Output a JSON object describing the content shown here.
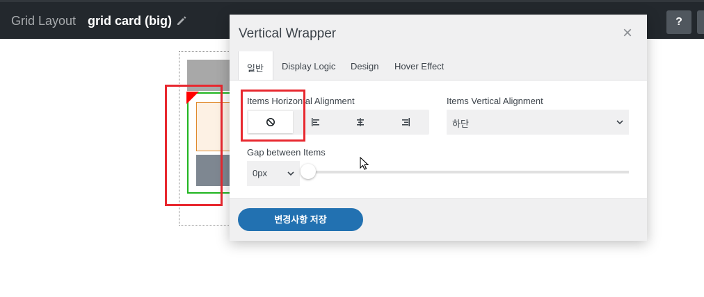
{
  "topbar": {
    "crumb": "Grid Layout",
    "title": "grid card (big)",
    "help_label": "?"
  },
  "dialog": {
    "title": "Vertical Wrapper",
    "tabs": [
      {
        "label": "일반",
        "active": true
      },
      {
        "label": "Display Logic",
        "active": false
      },
      {
        "label": "Design",
        "active": false
      },
      {
        "label": "Hover Effect",
        "active": false
      }
    ],
    "horizontal_alignment": {
      "label": "Items Horizontal Alignment",
      "options": [
        "none",
        "left",
        "center",
        "right"
      ],
      "selected": "none"
    },
    "vertical_alignment": {
      "label": "Items Vertical Alignment",
      "value": "하단"
    },
    "gap": {
      "label": "Gap between Items",
      "unit": "0px",
      "slider_value": 0
    },
    "save_label": "변경사항 저장"
  },
  "colors": {
    "topbar": "#23282d",
    "accent": "#2271b1",
    "highlight": "#e8282f",
    "green_outline": "#1fb51f"
  }
}
